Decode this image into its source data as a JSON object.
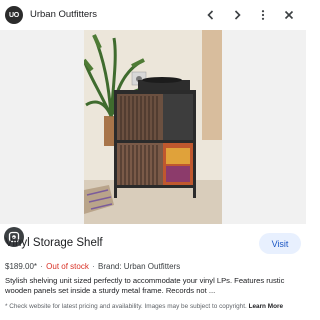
{
  "header": {
    "logo_text": "UO",
    "site_name": "Urban Outfitters",
    "icons": [
      "chevron-left-icon",
      "chevron-right-icon",
      "more-vert-icon",
      "close-icon"
    ]
  },
  "product": {
    "title": "Vinyl Storage Shelf",
    "price": "$189.00*",
    "separator": "·",
    "stock_status": "Out of stock",
    "brand": "Brand: Urban Outfitters",
    "description": "Stylish shelving unit sized perfectly to accommodate your vinyl LPs. Features rustic wooden panels set inside a sturdy metal frame. Records not ...",
    "visit_label": "Visit"
  },
  "footer": {
    "disclaimer": "* Check website for latest pricing and availability. Images may be subject to copyright.",
    "learn_more": "Learn More"
  },
  "colors": {
    "out_of_stock": "#d93025",
    "visit_button_bg": "#e8f0fe",
    "visit_button_text": "#1a56c4"
  }
}
